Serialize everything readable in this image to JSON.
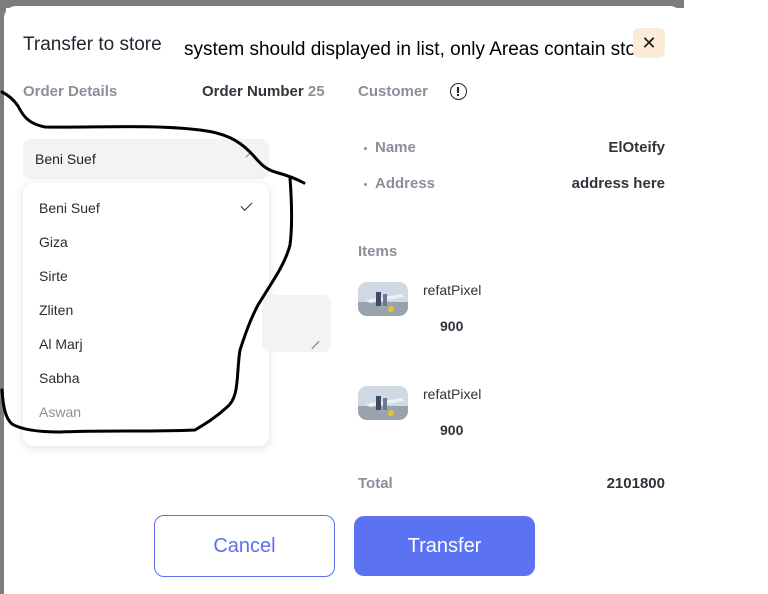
{
  "dialog": {
    "title": "Transfer to store",
    "annotation_note": "system should displayed in list, only Areas  contain store",
    "close_symbol": "✕"
  },
  "order": {
    "section_label": "Order Details",
    "order_number_label": "Order Number",
    "order_number_value": "25"
  },
  "customer": {
    "section_label": "Customer",
    "info_icon": "info-circle-icon",
    "name_label": "Name",
    "name_value": "ElOteify",
    "address_label": "Address",
    "address_value": "address here"
  },
  "area_select": {
    "selected_value": "Beni Suef",
    "options": [
      "Beni Suef",
      "Giza",
      "Sirte",
      "Zliten",
      "Al Marj",
      "Sabha",
      "Aswan"
    ],
    "checked_option": "Beni Suef"
  },
  "items": {
    "section_label": "Items",
    "list": [
      {
        "name": "refatPixel",
        "price": "900"
      },
      {
        "name": "refatPixel",
        "price": "900"
      }
    ]
  },
  "total": {
    "label": "Total",
    "value": "2101800"
  },
  "actions": {
    "cancel_label": "Cancel",
    "transfer_label": "Transfer"
  },
  "colors": {
    "primary": "#5b72f2",
    "close_bg": "#fdebd9",
    "muted_label": "#8a8f99",
    "frame": "#7d7d7d"
  }
}
